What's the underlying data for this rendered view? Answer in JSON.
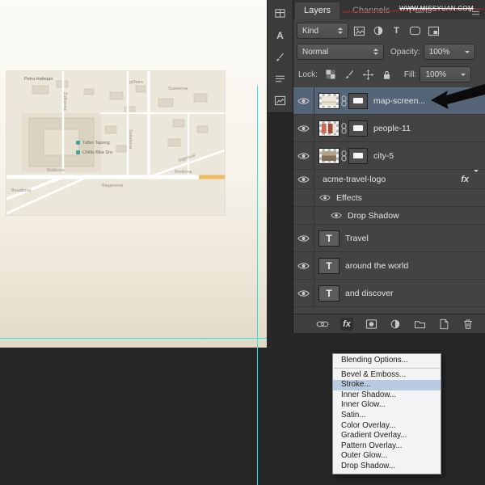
{
  "watermark": {
    "text": "WWW.MISSYUAN.COM"
  },
  "tabs": {
    "layers": "Layers",
    "channels": "Channels",
    "paths": "Paths"
  },
  "controls": {
    "kind": "Kind",
    "blend_mode": "Normal",
    "opacity_label": "Opacity:",
    "opacity_value": "100%",
    "lock_label": "Lock:",
    "fill_label": "Fill:",
    "fill_value": "100%"
  },
  "glyphs": {
    "type_thumb": "T",
    "filter_type": "T",
    "character_dock": "A"
  },
  "layers": [
    {
      "name": "map-screen...",
      "selected": true
    },
    {
      "name": "people-11"
    },
    {
      "name": "city-5"
    },
    {
      "name": "acme-travel-logo",
      "fx_label": "fx"
    },
    {
      "name": "Effects"
    },
    {
      "name": "Drop Shadow"
    },
    {
      "name": "Travel"
    },
    {
      "name": "around the world"
    },
    {
      "name": "and discover"
    }
  ],
  "bottombar": {
    "fx_label": "fx"
  },
  "menu": {
    "items": [
      "Blending Options...",
      "Bevel & Emboss...",
      "Stroke...",
      "Inner Shadow...",
      "Inner Glow...",
      "Satin...",
      "Color Overlay...",
      "Gradient Overlay...",
      "Pattern Overlay...",
      "Outer Glow...",
      "Drop Shadow..."
    ],
    "highlighted_item": "Stroke..."
  },
  "map": {
    "labels": [
      "Petra Hafeqan",
      "gOturo",
      "Susekova",
      "Žofkovna",
      "Sušekova",
      "Roškova",
      "Jogenval",
      "Tafiss Taperig",
      "Chillis Bike Sro",
      "Roskova",
      "Blagenova",
      "Bosákova"
    ]
  },
  "colors": {
    "guide": "#35e3de",
    "selection": "#546577",
    "menu_highlight": "#b9cbe2",
    "panel_background": "#434343"
  }
}
